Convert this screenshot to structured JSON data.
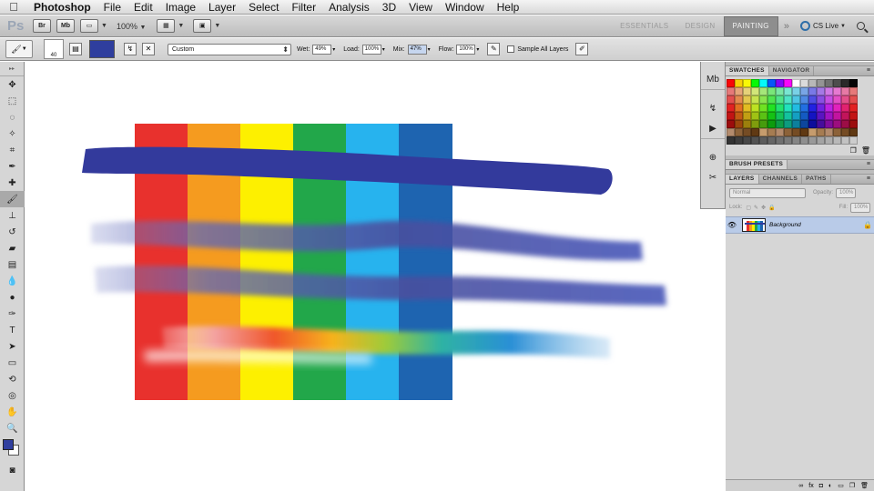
{
  "menubar": {
    "items": [
      "Photoshop",
      "File",
      "Edit",
      "Image",
      "Layer",
      "Select",
      "Filter",
      "Analysis",
      "3D",
      "View",
      "Window",
      "Help"
    ]
  },
  "appbar": {
    "logo": "Ps",
    "bridge_label": "Br",
    "minibridge_label": "Mb",
    "zoom": "100%",
    "workspaces": [
      "ESSENTIALS",
      "DESIGN",
      "PAINTING"
    ],
    "active_workspace": "PAINTING",
    "more_label": "»",
    "cslive_label": "CS Live"
  },
  "options": {
    "brush_size": "40",
    "preset": "Custom",
    "wet_label": "Wet:",
    "wet_value": "49%",
    "load_label": "Load:",
    "load_value": "100%",
    "mix_label": "Mix:",
    "mix_value": "47%",
    "flow_label": "Flow:",
    "flow_value": "100%",
    "sample_label": "Sample All Layers",
    "foreground_color": "#2f3e9e"
  },
  "panels": {
    "swatches_tab": "SWATCHES",
    "navigator_tab": "NAVIGATOR",
    "brush_presets_tab": "BRUSH PRESETS",
    "layers_tab": "LAYERS",
    "channels_tab": "CHANNELS",
    "paths_tab": "PATHS",
    "blend_mode": "Normal",
    "opacity_label": "Opacity:",
    "opacity_value": "100%",
    "lock_label": "Lock:",
    "fill_label": "Fill:",
    "fill_value": "100%",
    "layer_name": "Background"
  },
  "canvas": {
    "stripe_colors": [
      "#e8312d",
      "#f59b1f",
      "#fdf000",
      "#22a74a",
      "#27b3ee",
      "#1e64b0"
    ],
    "stroke_color": "#333a9c"
  }
}
